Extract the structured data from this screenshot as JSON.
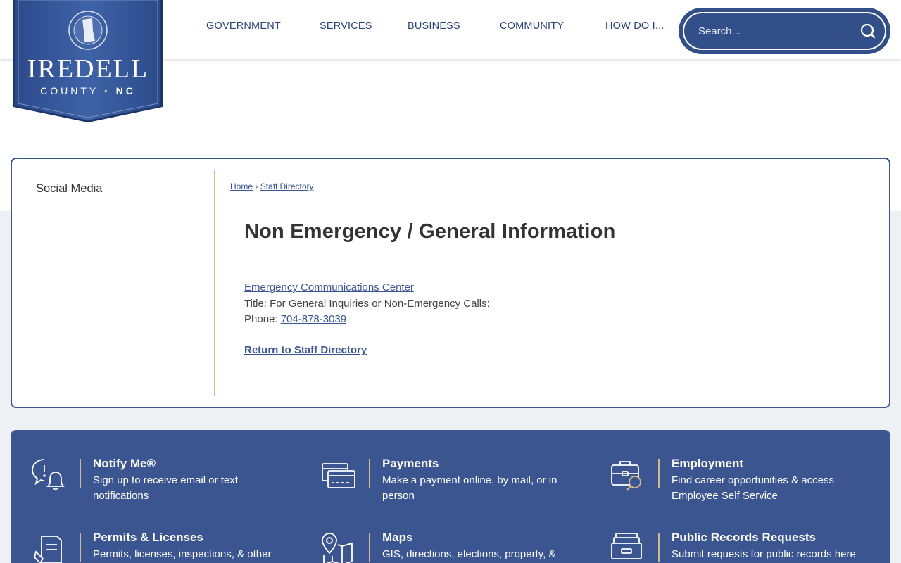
{
  "logo": {
    "name": "IREDELL",
    "sub": "COUNTY",
    "state": "NC"
  },
  "nav": {
    "items": [
      {
        "label": "GOVERNMENT"
      },
      {
        "label": "SERVICES"
      },
      {
        "label": "BUSINESS"
      },
      {
        "label": "COMMUNITY"
      },
      {
        "label": "HOW DO I..."
      }
    ]
  },
  "search": {
    "placeholder": "Search..."
  },
  "sidebar": {
    "title": "Social Media"
  },
  "breadcrumb": {
    "home": "Home",
    "separator": "›",
    "current": "Staff Directory"
  },
  "main": {
    "title": "Non Emergency / General Information",
    "department": "Emergency Communications Center",
    "title_label": "Title:",
    "title_value": "For General Inquiries or Non-Emergency Calls:",
    "phone_label": "Phone:",
    "phone_value": "704-878-3039",
    "return_link": "Return to Staff Directory"
  },
  "quick_links": [
    {
      "icon": "notify-bell-icon",
      "title": "Notify Me®",
      "desc": "Sign up to receive email or text notifications"
    },
    {
      "icon": "payment-card-icon",
      "title": "Payments",
      "desc": "Make a payment online, by mail, or in person"
    },
    {
      "icon": "briefcase-search-icon",
      "title": "Employment",
      "desc": "Find career opportunities & access Employee Self Service"
    },
    {
      "icon": "permit-document-icon",
      "title": "Permits & Licenses",
      "desc": "Permits, licenses, inspections, & other"
    },
    {
      "icon": "map-pin-icon",
      "title": "Maps",
      "desc": "GIS, directions, elections, property, &"
    },
    {
      "icon": "records-tray-icon",
      "title": "Public Records Requests",
      "desc": "Submit requests for public records here"
    }
  ],
  "colors": {
    "brand_blue": "#3b5590",
    "accent_gold": "#d3b98b",
    "nav_text": "#2b4478"
  }
}
